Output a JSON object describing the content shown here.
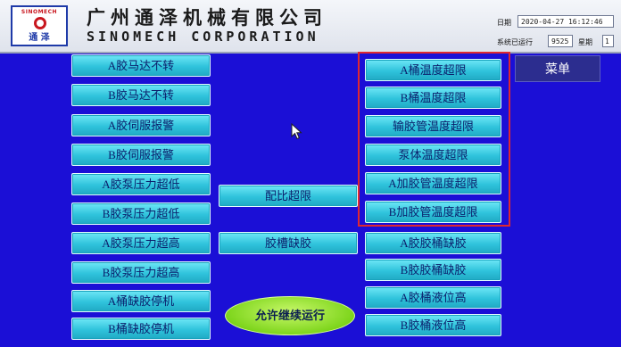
{
  "header": {
    "logo_top_text": "SINOMECH",
    "logo_bottom_text": "通 泽",
    "company_cn": "广州通泽机械有限公司",
    "company_en": "SINOMECH CORPORATION",
    "date_label": "日期",
    "date_value": "2020-04-27  16:12:46",
    "runtime_label": "系统已运行",
    "runtime_value": "9525",
    "weekday_label": "星期",
    "weekday_value": "1"
  },
  "left_alarms": [
    "A胶马达不转",
    "B胶马达不转",
    "A胶伺服报警",
    "B胶伺服报警",
    "A胶泵压力超低",
    "B胶泵压力超低",
    "A胶泵压力超高",
    "B胶泵压力超高",
    "A桶缺胶停机",
    "B桶缺胶停机"
  ],
  "middle_alarms": [
    "配比超限",
    "胶槽缺胶"
  ],
  "right_alarms_highlighted": [
    "A桶温度超限",
    "B桶温度超限",
    "输胶管温度超限",
    "泵体温度超限",
    "A加胶管温度超限",
    "B加胶管温度超限"
  ],
  "right_alarms": [
    "A胶胶桶缺胶",
    "B胶胶桶缺胶",
    "A胶桶液位高",
    "B胶桶液位高"
  ],
  "menu_label": "菜单",
  "continue_label": "允许继续运行",
  "colors": {
    "background": "#1b0fd6",
    "button": "#2fc3dc",
    "highlight_frame": "#e0282f",
    "continue": "#7ed51c"
  }
}
